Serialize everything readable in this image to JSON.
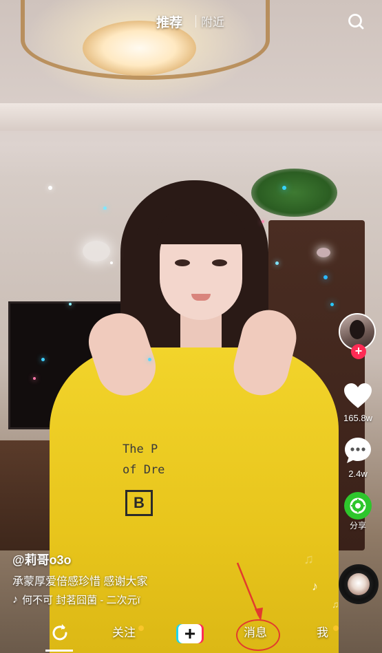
{
  "top_tabs": {
    "recommend": "推荐",
    "nearby": "附近"
  },
  "icons": {
    "search": "search-icon",
    "heart": "heart-icon",
    "comment": "comment-icon",
    "share": "share-icon",
    "note": "music-note-icon",
    "refresh": "refresh-icon",
    "plus": "plus-icon"
  },
  "rail": {
    "likes": "165.8w",
    "comments": "2.4w",
    "share": "分享",
    "follow_plus": "+"
  },
  "post": {
    "username": "@莉哥o3o",
    "caption": "承蒙厚爱倍感珍惜 感谢大家",
    "music": "何不可 封茗囧菌 - 二次元ï"
  },
  "nav": {
    "follow": "关注",
    "messages": "消息",
    "me": "我"
  },
  "shirt_print": {
    "line1": "The P",
    "line2": "of Dre",
    "letter": "B"
  },
  "colors": {
    "accent_red": "#fe2c55",
    "share_green": "#2ec62c",
    "dot_yellow": "#f9c62b",
    "annotation_red": "#e23b2e"
  }
}
